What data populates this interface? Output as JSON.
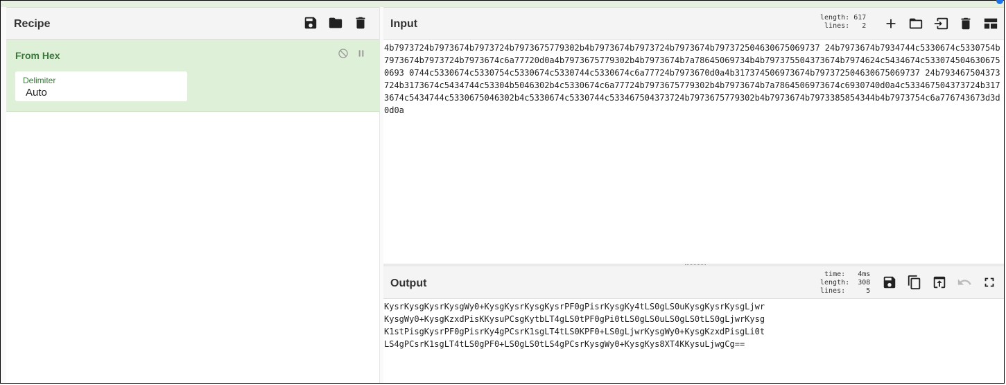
{
  "recipe": {
    "title": "Recipe",
    "operation": {
      "name": "From Hex",
      "delimiter_label": "Delimiter",
      "delimiter_value": "Auto"
    }
  },
  "input": {
    "title": "Input",
    "stats": {
      "length_label": "length:",
      "length_value": "617",
      "lines_label": "lines:",
      "lines_value": "2"
    },
    "text": "4b7973724b7973674b7973724b7973675779302b4b7973674b7973724b7973674b797372504630675069737 24b7973674b7934744c5330674c5330754b7973674b7973724b7973674c6a77720d0a4b7973675779302b4b7973674b7a78645069734b4b797375504373674b7974624c5434674c5330745046306750693 0744c5330674c5330754c5330674c5330744c5330674c6a77724b7973670d0a4b317374506973674b797372504630675069737 24b793467504373724b3173674c5434744c53304b5046302b4c5330674c6a77724b7973675779302b4b7973674b7a7864506973674c6930740d0a4c533467504373724b3173674c5434744c5330675046302b4c5330674c5330744c533467504373724b7973675779302b4b7973674b7973385854344b4b7973754c6a776743673d3d0d0a"
  },
  "output": {
    "title": "Output",
    "stats": {
      "time_label": "time:",
      "time_value": "4ms",
      "length_label": "length:",
      "length_value": "308",
      "lines_label": "lines:",
      "lines_value": "5"
    },
    "text": "KysrKysgKysrKysgWy0+KysgKysrKysgKysrPF0gPisrKysgKy4tLS0gLS0uKysgKysrKysgLjwr\nKysgWy0+KysgKzxdPisKKysuPCsgKytbLT4gLS0tPF0gPi0tLS0gLS0uLS0gLS0tLS0gLjwrKysg\nK1stPisgKysrPF0gPisrKy4gPCsrK1sgLT4tLS0KPF0+LS0gLjwrKysgWy0+KysgKzxdPisgLi0t\nLS4gPCsrK1sgLT4tLS0gPF0+LS0gLS0tLS4gPCsrKysgWy0+KysgKys8XT4KKysuLjwgCg=="
  }
}
